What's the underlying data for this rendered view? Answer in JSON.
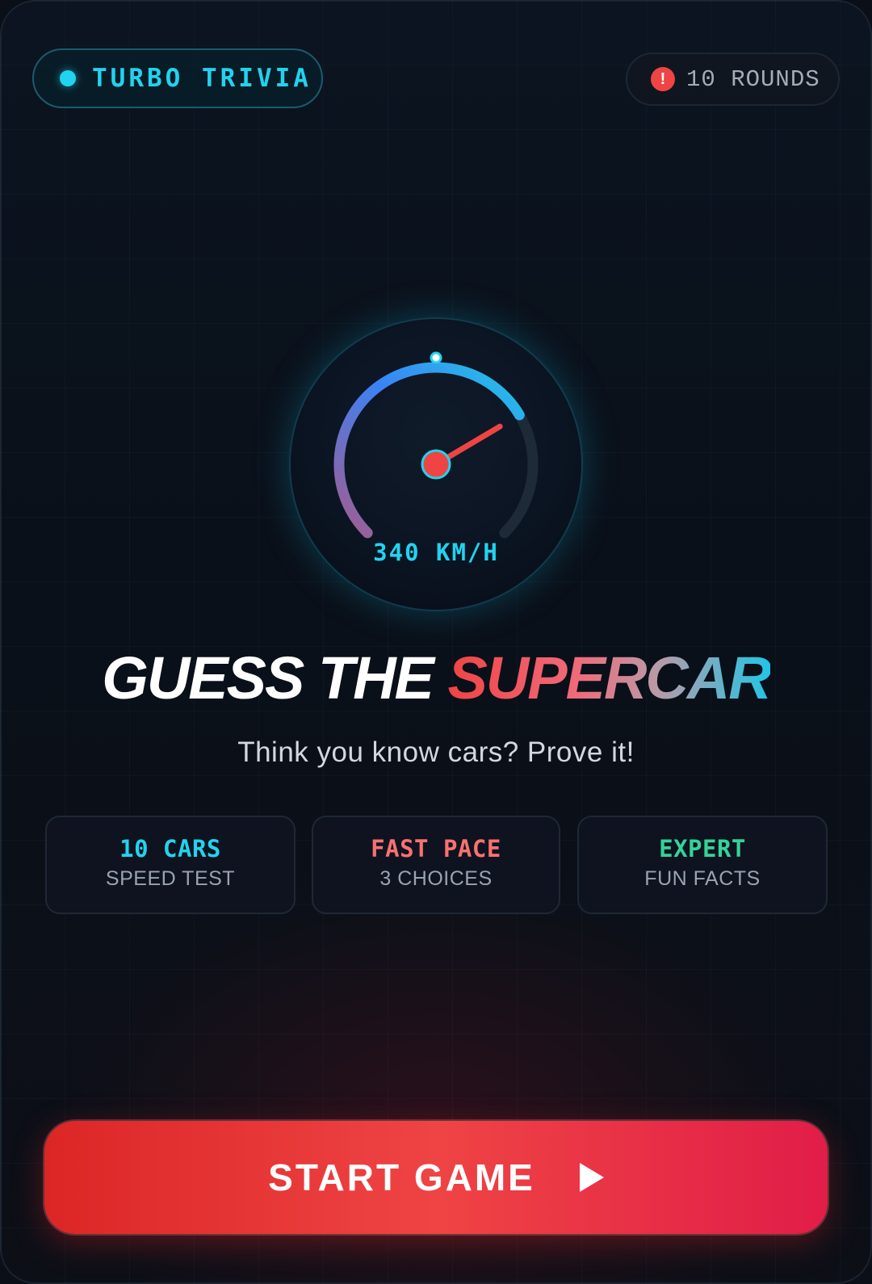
{
  "header": {
    "brand": "TURBO TRIVIA",
    "rounds_label": "10 ROUNDS",
    "alert_glyph": "!"
  },
  "gauge": {
    "speed_label": "340 KM/H",
    "level_fraction": 0.72,
    "colors": {
      "arc_start": "#a35c8f",
      "arc_mid": "#3b82f6",
      "arc_end": "#22c5e6",
      "track": "#1f2a38",
      "needle": "#ef4444",
      "hub_ring": "#22d3ee"
    }
  },
  "hero": {
    "title_part1": "GUESS THE ",
    "title_part2": "SUPERCAR",
    "subtitle": "Think you know cars? Prove it!"
  },
  "features": [
    {
      "title": "10 CARS",
      "subtitle": "SPEED TEST",
      "color": "#22d3ee"
    },
    {
      "title": "FAST PACE",
      "subtitle": "3 CHOICES",
      "color": "#f87171"
    },
    {
      "title": "EXPERT",
      "subtitle": "FUN FACTS",
      "color": "#34d399"
    }
  ],
  "start_button": {
    "label": "START GAME",
    "icon": "play-icon"
  },
  "theme": {
    "accent_cyan": "#22d3ee",
    "accent_red": "#ef4444",
    "accent_green": "#34d399"
  }
}
